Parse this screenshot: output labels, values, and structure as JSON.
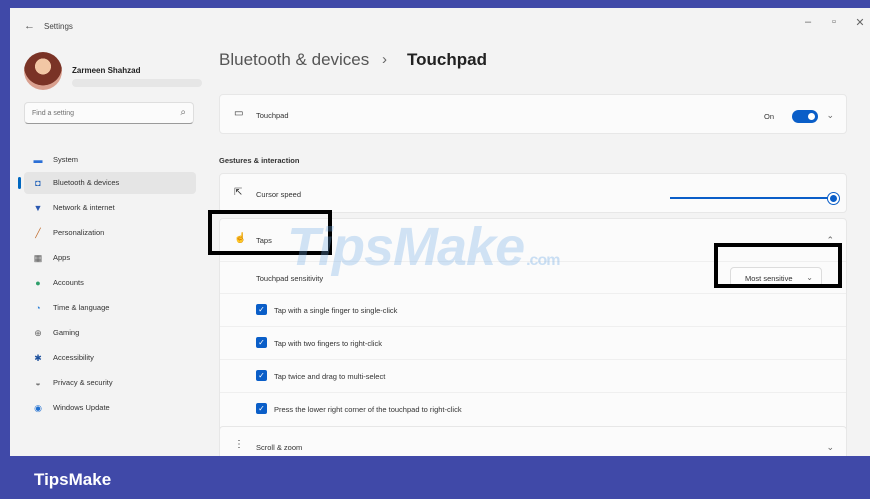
{
  "window": {
    "title": "Settings",
    "back_glyph": "←",
    "minimize_glyph": "–",
    "maximize_glyph": "▫",
    "close_glyph": "✕"
  },
  "user": {
    "name": "Zarmeen Shahzad"
  },
  "search": {
    "placeholder": "Find a setting",
    "icon": "search-icon"
  },
  "nav": {
    "active_index": 1,
    "items": [
      {
        "label": "System",
        "icon": "system-icon",
        "glyph": "▬",
        "color": "#2b6fd6"
      },
      {
        "label": "Bluetooth & devices",
        "icon": "bluetooth-icon",
        "glyph": "◘",
        "color": "#1d5fb8"
      },
      {
        "label": "Network & internet",
        "icon": "wifi-icon",
        "glyph": "▼",
        "color": "#2a58b0"
      },
      {
        "label": "Personalization",
        "icon": "brush-icon",
        "glyph": "╱",
        "color": "#c06a2a"
      },
      {
        "label": "Apps",
        "icon": "apps-icon",
        "glyph": "▦",
        "color": "#555555"
      },
      {
        "label": "Accounts",
        "icon": "accounts-icon",
        "glyph": "●",
        "color": "#2e9e6a"
      },
      {
        "label": "Time & language",
        "icon": "globe-icon",
        "glyph": "◔",
        "color": "#2b7fd6"
      },
      {
        "label": "Gaming",
        "icon": "gaming-icon",
        "glyph": "⊕",
        "color": "#666666"
      },
      {
        "label": "Accessibility",
        "icon": "accessibility-icon",
        "glyph": "✱",
        "color": "#1b4f9c"
      },
      {
        "label": "Privacy & security",
        "icon": "shield-icon",
        "glyph": "◒",
        "color": "#777777"
      },
      {
        "label": "Windows Update",
        "icon": "update-icon",
        "glyph": "◉",
        "color": "#1f6fd0"
      }
    ]
  },
  "breadcrumb": {
    "parent": "Bluetooth & devices",
    "separator": "›",
    "current": "Touchpad"
  },
  "touchpad_card": {
    "icon": "touchpad-icon",
    "glyph": "▭",
    "label": "Touchpad",
    "toggle_label": "On",
    "toggle_on": true,
    "chevron": "⌄"
  },
  "gestures": {
    "section_title": "Gestures & interaction",
    "cursor": {
      "icon": "cursor-icon",
      "glyph": "⇱",
      "label": "Cursor speed",
      "value_fraction": 1.0
    },
    "taps": {
      "icon": "tap-icon",
      "glyph": "☝",
      "label": "Taps",
      "chevron": "⌃",
      "sensitivity_label": "Touchpad sensitivity",
      "sensitivity_value": "Most sensitive",
      "dropdown_chevron": "⌄",
      "check_glyph": "✓",
      "options": [
        {
          "label": "Tap with a single finger to single-click",
          "checked": true
        },
        {
          "label": "Tap with two fingers to right-click",
          "checked": true
        },
        {
          "label": "Tap twice and drag to multi-select",
          "checked": true
        },
        {
          "label": "Press the lower right corner of the touchpad to right-click",
          "checked": true
        }
      ]
    },
    "scroll": {
      "icon": "scroll-icon",
      "glyph": "⋮",
      "label": "Scroll & zoom",
      "chevron": "⌄"
    }
  },
  "watermark": {
    "text": "TipsMake",
    "suffix": ".com"
  },
  "footer": {
    "brand": "TipsMake"
  },
  "colors": {
    "accent": "#0a5ec8",
    "frame": "#4049a8"
  }
}
